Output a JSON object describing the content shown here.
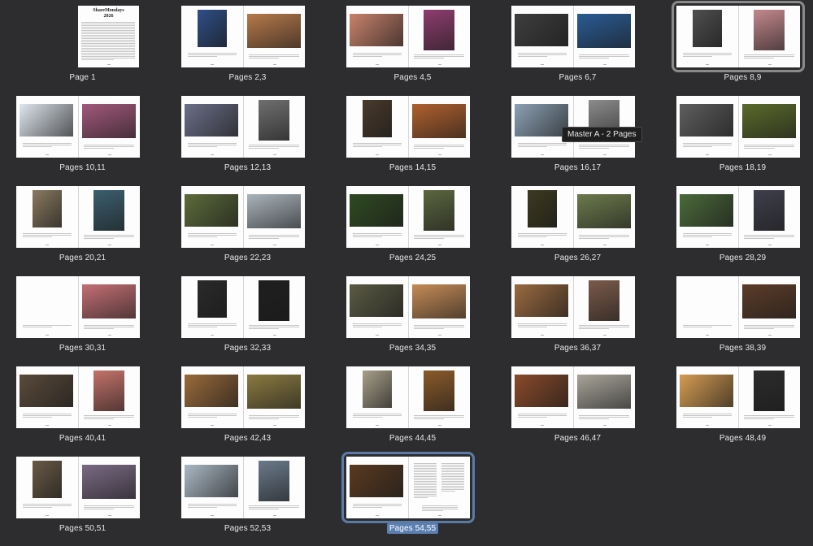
{
  "tooltip": "Master A - 2 Pages",
  "cover": {
    "title_line1": "ShareMondays",
    "title_line2": "2026"
  },
  "spreads": [
    {
      "label": "Page 1",
      "left": null,
      "right": {
        "kind": "cover"
      }
    },
    {
      "label": "Pages 2,3",
      "left": "#2e4f87",
      "right": "#b6794a"
    },
    {
      "label": "Pages 4,5",
      "left": "#c9826c",
      "right": "#8e3d6e"
    },
    {
      "label": "Pages 6,7",
      "left": "#3e3e3e",
      "right": "#2a5b94"
    },
    {
      "label": "Pages 8,9",
      "left": "#4f4f4f",
      "right": "#c3888c",
      "state": "highlighted"
    },
    {
      "label": "Pages 10,11",
      "left": "#dfe6ee",
      "right": "#a2587b"
    },
    {
      "label": "Pages 12,13",
      "left": "#6b6f88",
      "right": "#6f6f6f"
    },
    {
      "label": "Pages 14,15",
      "left": "#4a3a2c",
      "right": "#b0602e"
    },
    {
      "label": "Pages 16,17",
      "left": "#8ca1b4",
      "right": "#8c8c8c"
    },
    {
      "label": "Pages 18,19",
      "left": "#5e5e5e",
      "right": "#5a6a2a"
    },
    {
      "label": "Pages 20,21",
      "left": "#8a7a60",
      "right": "#3b5e6e"
    },
    {
      "label": "Pages 22,23",
      "left": "#5c6b3a",
      "right": "#aab4bc"
    },
    {
      "label": "Pages 24,25",
      "left": "#2f4a22",
      "right": "#5b6640"
    },
    {
      "label": "Pages 26,27",
      "left": "#3c3a1e",
      "right": "#6c7a4c"
    },
    {
      "label": "Pages 28,29",
      "left": "#4b6a3a",
      "right": "#3f3f4c"
    },
    {
      "label": "Pages 30,31",
      "left": null,
      "right": "#c46f74"
    },
    {
      "label": "Pages 32,33",
      "left": "#2a2a2a",
      "right": "#1f1f1f"
    },
    {
      "label": "Pages 34,35",
      "left": "#5a5a44",
      "right": "#c58b57"
    },
    {
      "label": "Pages 36,37",
      "left": "#9a6a40",
      "right": "#7a5a4a"
    },
    {
      "label": "Pages 38,39",
      "left": null,
      "right": "#5c3c28"
    },
    {
      "label": "Pages 40,41",
      "left": "#5a4a3a",
      "right": "#c4726a"
    },
    {
      "label": "Pages 42,43",
      "left": "#9a6a3a",
      "right": "#8a7a40"
    },
    {
      "label": "Pages 44,45",
      "left": "#a8a08a",
      "right": "#8a5a2a"
    },
    {
      "label": "Pages 46,47",
      "left": "#8a4a2a",
      "right": "#a8a49a"
    },
    {
      "label": "Pages 48,49",
      "left": "#d69c52",
      "right": "#2c2c2c"
    },
    {
      "label": "Pages 50,51",
      "left": "#6a5a46",
      "right": "#7a6a84"
    },
    {
      "label": "Pages 52,53",
      "left": "#aab8c4",
      "right": "#6a7a8a"
    },
    {
      "label": "Pages 54,55",
      "left": "#5a3a20",
      "right": {
        "kind": "index"
      },
      "state": "selected"
    }
  ]
}
